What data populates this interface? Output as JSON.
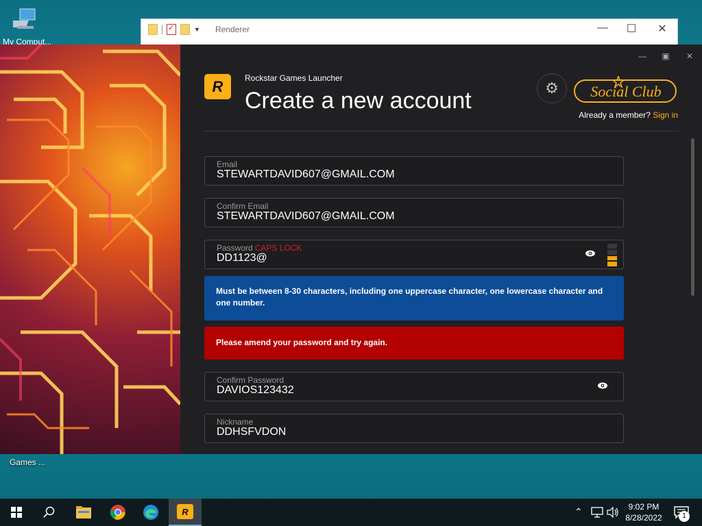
{
  "desktop": {
    "icon_this_pc_label": "My Comput...",
    "icon_games_label": "Games ..."
  },
  "explorer": {
    "title": "Renderer",
    "minimize": "—",
    "maximize": "☐",
    "close": "✕"
  },
  "launcher": {
    "app_name": "Rockstar Games Launcher",
    "page_title": "Create a new account",
    "logo_text": "R",
    "social_club_logo": "Social Club",
    "already_member": "Already a member?",
    "sign_in": "Sign in",
    "window_controls": {
      "minimize": "—",
      "maximize": "▣",
      "close": "✕"
    },
    "fields": {
      "email": {
        "label": "Email",
        "value": "STEWARTDAVID607@GMAIL.COM"
      },
      "confirm_email": {
        "label": "Confirm Email",
        "value": "STEWARTDAVID607@GMAIL.COM"
      },
      "password": {
        "label": "Password",
        "caps_lock": "CAPS LOCK",
        "value": "DD1123@",
        "strength_level": 2,
        "strength_max": 4
      },
      "confirm_password": {
        "label": "Confirm Password",
        "value": "DAVIOS123432"
      },
      "nickname": {
        "label": "Nickname",
        "value": "DDHSFVDON"
      }
    },
    "messages": {
      "info": "Must be between 8-30 characters, including one uppercase character, one lowercase character and one number.",
      "error": "Please amend your password and try again."
    },
    "colors": {
      "accent": "#fcaf17",
      "info_bg": "#0d4d98",
      "error_bg": "#b30000",
      "caps_lock": "#d61f1f"
    }
  },
  "taskbar": {
    "time": "9:02 PM",
    "date": "8/28/2022",
    "notification_count": "1",
    "apps": [
      "start-icon",
      "search-icon",
      "file-explorer-icon",
      "chrome-icon",
      "edge-icon",
      "rockstar-launcher-icon"
    ]
  }
}
